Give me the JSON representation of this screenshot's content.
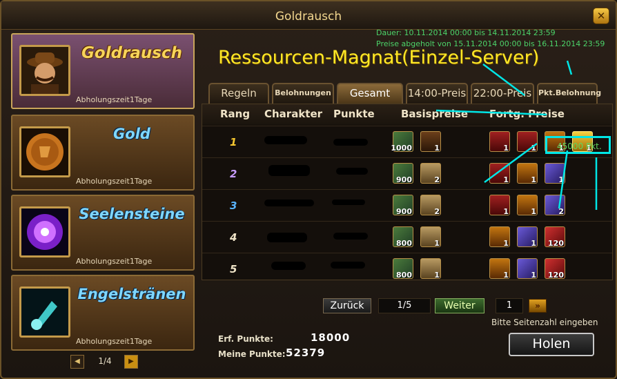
{
  "window": {
    "title": "Goldrausch",
    "close_label": "✕"
  },
  "events": [
    {
      "title": "Goldrausch",
      "subtitle": "Abholungszeit1Tage",
      "selected": true
    },
    {
      "title": "Gold",
      "subtitle": "Abholungszeit1Tage",
      "selected": false
    },
    {
      "title": "Seelensteine",
      "subtitle": "Abholungszeit1Tage",
      "selected": false
    },
    {
      "title": "Engelstränen",
      "subtitle": "Abholungszeit1Tage",
      "selected": false
    }
  ],
  "left_pager": {
    "text": "1/4",
    "prev": "◀",
    "next": "▶"
  },
  "info": {
    "duration": "Dauer: 10.11.2014 00:00 bis 14.11.2014 23:59",
    "claim": "Preise abgeholt von 15.11.2014 00:00 bis 16.11.2014 23:59"
  },
  "banner": "Ressourcen-Magnat(Einzel-Server)",
  "tabs": [
    "Regeln",
    "Belohnungen",
    "Gesamt",
    "14:00-Preis",
    "22:00-Preis",
    "Pkt.Belohnung"
  ],
  "active_tab": "Gesamt",
  "table": {
    "headers": {
      "rank": "Rang",
      "character": "Charakter",
      "points": "Punkte",
      "base": "Basispreise",
      "advanced": "Fortg. Preise"
    },
    "points_label": "45000 Pkt.",
    "rows": [
      {
        "rank": "1",
        "base": [
          {
            "type": "scroll",
            "qty": "1000"
          },
          {
            "type": "chest",
            "qty": "1"
          }
        ],
        "adv": [
          {
            "type": "armor",
            "qty": "1"
          },
          {
            "type": "armor",
            "qty": "1"
          },
          {
            "type": "armor2",
            "qty": "1"
          },
          {
            "type": "goldsh",
            "qty": "1"
          }
        ]
      },
      {
        "rank": "2",
        "base": [
          {
            "type": "scroll",
            "qty": "900"
          },
          {
            "type": "chest g",
            "qty": "2"
          }
        ],
        "adv": [
          {
            "type": "armor",
            "qty": "1"
          },
          {
            "type": "armor2",
            "qty": "1"
          },
          {
            "type": "gemp",
            "qty": "1"
          }
        ]
      },
      {
        "rank": "3",
        "base": [
          {
            "type": "scroll",
            "qty": "900"
          },
          {
            "type": "chest g",
            "qty": "2"
          }
        ],
        "adv": [
          {
            "type": "armor",
            "qty": "1"
          },
          {
            "type": "armor2",
            "qty": "1"
          },
          {
            "type": "gemp",
            "qty": "2"
          }
        ]
      },
      {
        "rank": "4",
        "base": [
          {
            "type": "scroll",
            "qty": "800"
          },
          {
            "type": "chest g",
            "qty": "1"
          }
        ],
        "adv": [
          {
            "type": "armor2",
            "qty": "1"
          },
          {
            "type": "gemp",
            "qty": "1"
          },
          {
            "type": "gemr",
            "qty": "120"
          }
        ]
      },
      {
        "rank": "5",
        "base": [
          {
            "type": "scroll",
            "qty": "800"
          },
          {
            "type": "chest g",
            "qty": "1"
          }
        ],
        "adv": [
          {
            "type": "armor2",
            "qty": "1"
          },
          {
            "type": "gemp",
            "qty": "1"
          },
          {
            "type": "gemr",
            "qty": "120"
          }
        ]
      }
    ]
  },
  "pager": {
    "back": "Zurück",
    "page": "1/5",
    "next": "Weiter",
    "page_input": "1",
    "go": "»",
    "hint": "Bitte Seitenzahl eingeben"
  },
  "stats": {
    "required_label": "Erf. Punkte:",
    "required_value": "18000",
    "my_label": "Meine Punkte:",
    "my_value": "52379"
  },
  "claim_button": "Holen",
  "colors": {
    "rank1": "#f7c830",
    "rank2": "#c89cff",
    "rank3": "#5ab4ff",
    "rank_other": "#f0e4c8",
    "annotation": "#00e6e6"
  }
}
